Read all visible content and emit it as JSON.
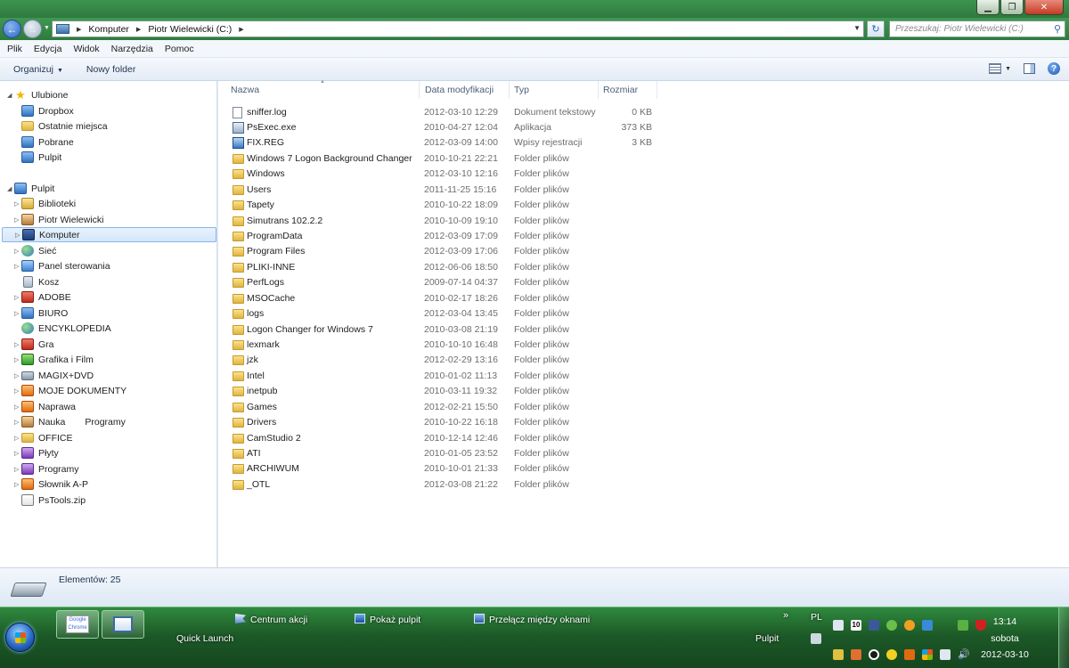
{
  "window": {
    "minimize_icon": "minimize-icon",
    "maximize_icon": "restore-icon",
    "close_icon": "close-icon"
  },
  "address": {
    "crumbs": [
      "Komputer",
      "Piotr Wielewicki (C:)"
    ],
    "search_placeholder": "Przeszukaj: Piotr Wielewicki (C:)"
  },
  "menu": [
    "Plik",
    "Edycja",
    "Widok",
    "Narzędzia",
    "Pomoc"
  ],
  "toolbar": {
    "organize": "Organizuj",
    "new_folder": "Nowy folder"
  },
  "nav": {
    "favorites": {
      "label": "Ulubione",
      "items": [
        "Dropbox",
        "Ostatnie miejsca",
        "Pobrane",
        "Pulpit"
      ]
    },
    "desktop": {
      "label": "Pulpit",
      "items": [
        "Biblioteki",
        "Piotr Wielewicki",
        "Komputer",
        "Sieć",
        "Panel sterowania",
        "Kosz",
        "ADOBE",
        "BIURO",
        "ENCYKLOPEDIA",
        "Gra",
        "Grafika i Film",
        "MAGIX+DVD",
        "MOJE DOKUMENTY",
        "Naprawa",
        "Nauka",
        "OFFICE",
        "Płyty",
        "Programy",
        "Słownik A-P",
        "PsTools.zip"
      ],
      "extra_label": "Programy"
    }
  },
  "columns": {
    "name": "Nazwa",
    "date": "Data modyfikacji",
    "type": "Typ",
    "size": "Rozmiar"
  },
  "files": [
    {
      "name": "sniffer.log",
      "date": "2012-03-10 12:29",
      "type": "Dokument tekstowy",
      "size": "0 KB",
      "icon": "text-file-icon"
    },
    {
      "name": "PsExec.exe",
      "date": "2010-04-27 12:04",
      "type": "Aplikacja",
      "size": "373 KB",
      "icon": "application-icon"
    },
    {
      "name": "FIX.REG",
      "date": "2012-03-09 14:00",
      "type": "Wpisy rejestracji",
      "size": "3 KB",
      "icon": "registry-file-icon"
    },
    {
      "name": "Windows 7 Logon Background Changer",
      "date": "2010-10-21 22:21",
      "type": "Folder plików",
      "size": "",
      "icon": "folder-icon"
    },
    {
      "name": "Windows",
      "date": "2012-03-10 12:16",
      "type": "Folder plików",
      "size": "",
      "icon": "folder-icon"
    },
    {
      "name": "Users",
      "date": "2011-11-25 15:16",
      "type": "Folder plików",
      "size": "",
      "icon": "folder-icon"
    },
    {
      "name": "Tapety",
      "date": "2010-10-22 18:09",
      "type": "Folder plików",
      "size": "",
      "icon": "folder-icon"
    },
    {
      "name": "Simutrans 102.2.2",
      "date": "2010-10-09 19:10",
      "type": "Folder plików",
      "size": "",
      "icon": "folder-icon"
    },
    {
      "name": "ProgramData",
      "date": "2012-03-09 17:09",
      "type": "Folder plików",
      "size": "",
      "icon": "folder-icon"
    },
    {
      "name": "Program Files",
      "date": "2012-03-09 17:06",
      "type": "Folder plików",
      "size": "",
      "icon": "folder-icon"
    },
    {
      "name": "PLIKI-INNE",
      "date": "2012-06-06 18:50",
      "type": "Folder plików",
      "size": "",
      "icon": "folder-icon"
    },
    {
      "name": "PerfLogs",
      "date": "2009-07-14 04:37",
      "type": "Folder plików",
      "size": "",
      "icon": "folder-icon"
    },
    {
      "name": "MSOCache",
      "date": "2010-02-17 18:26",
      "type": "Folder plików",
      "size": "",
      "icon": "folder-icon"
    },
    {
      "name": "logs",
      "date": "2012-03-04 13:45",
      "type": "Folder plików",
      "size": "",
      "icon": "folder-icon"
    },
    {
      "name": "Logon Changer for Windows 7",
      "date": "2010-03-08 21:19",
      "type": "Folder plików",
      "size": "",
      "icon": "folder-icon"
    },
    {
      "name": "lexmark",
      "date": "2010-10-10 16:48",
      "type": "Folder plików",
      "size": "",
      "icon": "folder-icon"
    },
    {
      "name": "jzk",
      "date": "2012-02-29 13:16",
      "type": "Folder plików",
      "size": "",
      "icon": "folder-icon"
    },
    {
      "name": "Intel",
      "date": "2010-01-02 11:13",
      "type": "Folder plików",
      "size": "",
      "icon": "folder-icon"
    },
    {
      "name": "inetpub",
      "date": "2010-03-11 19:32",
      "type": "Folder plików",
      "size": "",
      "icon": "folder-icon"
    },
    {
      "name": "Games",
      "date": "2012-02-21 15:50",
      "type": "Folder plików",
      "size": "",
      "icon": "folder-icon"
    },
    {
      "name": "Drivers",
      "date": "2010-10-22 16:18",
      "type": "Folder plików",
      "size": "",
      "icon": "folder-icon"
    },
    {
      "name": "CamStudio 2",
      "date": "2010-12-14 12:46",
      "type": "Folder plików",
      "size": "",
      "icon": "folder-icon"
    },
    {
      "name": "ATI",
      "date": "2010-01-05 23:52",
      "type": "Folder plików",
      "size": "",
      "icon": "folder-icon"
    },
    {
      "name": "ARCHIWUM",
      "date": "2010-10-01 21:33",
      "type": "Folder plików",
      "size": "",
      "icon": "folder-icon"
    },
    {
      "name": "_OTL",
      "date": "2012-03-08 21:22",
      "type": "Folder plików",
      "size": "",
      "icon": "folder-icon"
    }
  ],
  "details": {
    "count": "Elementów: 25"
  },
  "taskbar": {
    "quick_launch": "Quick Launch",
    "action_center": "Centrum akcji",
    "show_desktop": "Pokaż pulpit",
    "switch_windows": "Przełącz między oknami",
    "desktop_toolbar": "Pulpit",
    "chevron": "»",
    "language": "PL",
    "chrome_pin_text": "Google Chrome",
    "tray_number": "10",
    "time": "13:14",
    "day": "sobota",
    "date": "2012-03-10"
  }
}
